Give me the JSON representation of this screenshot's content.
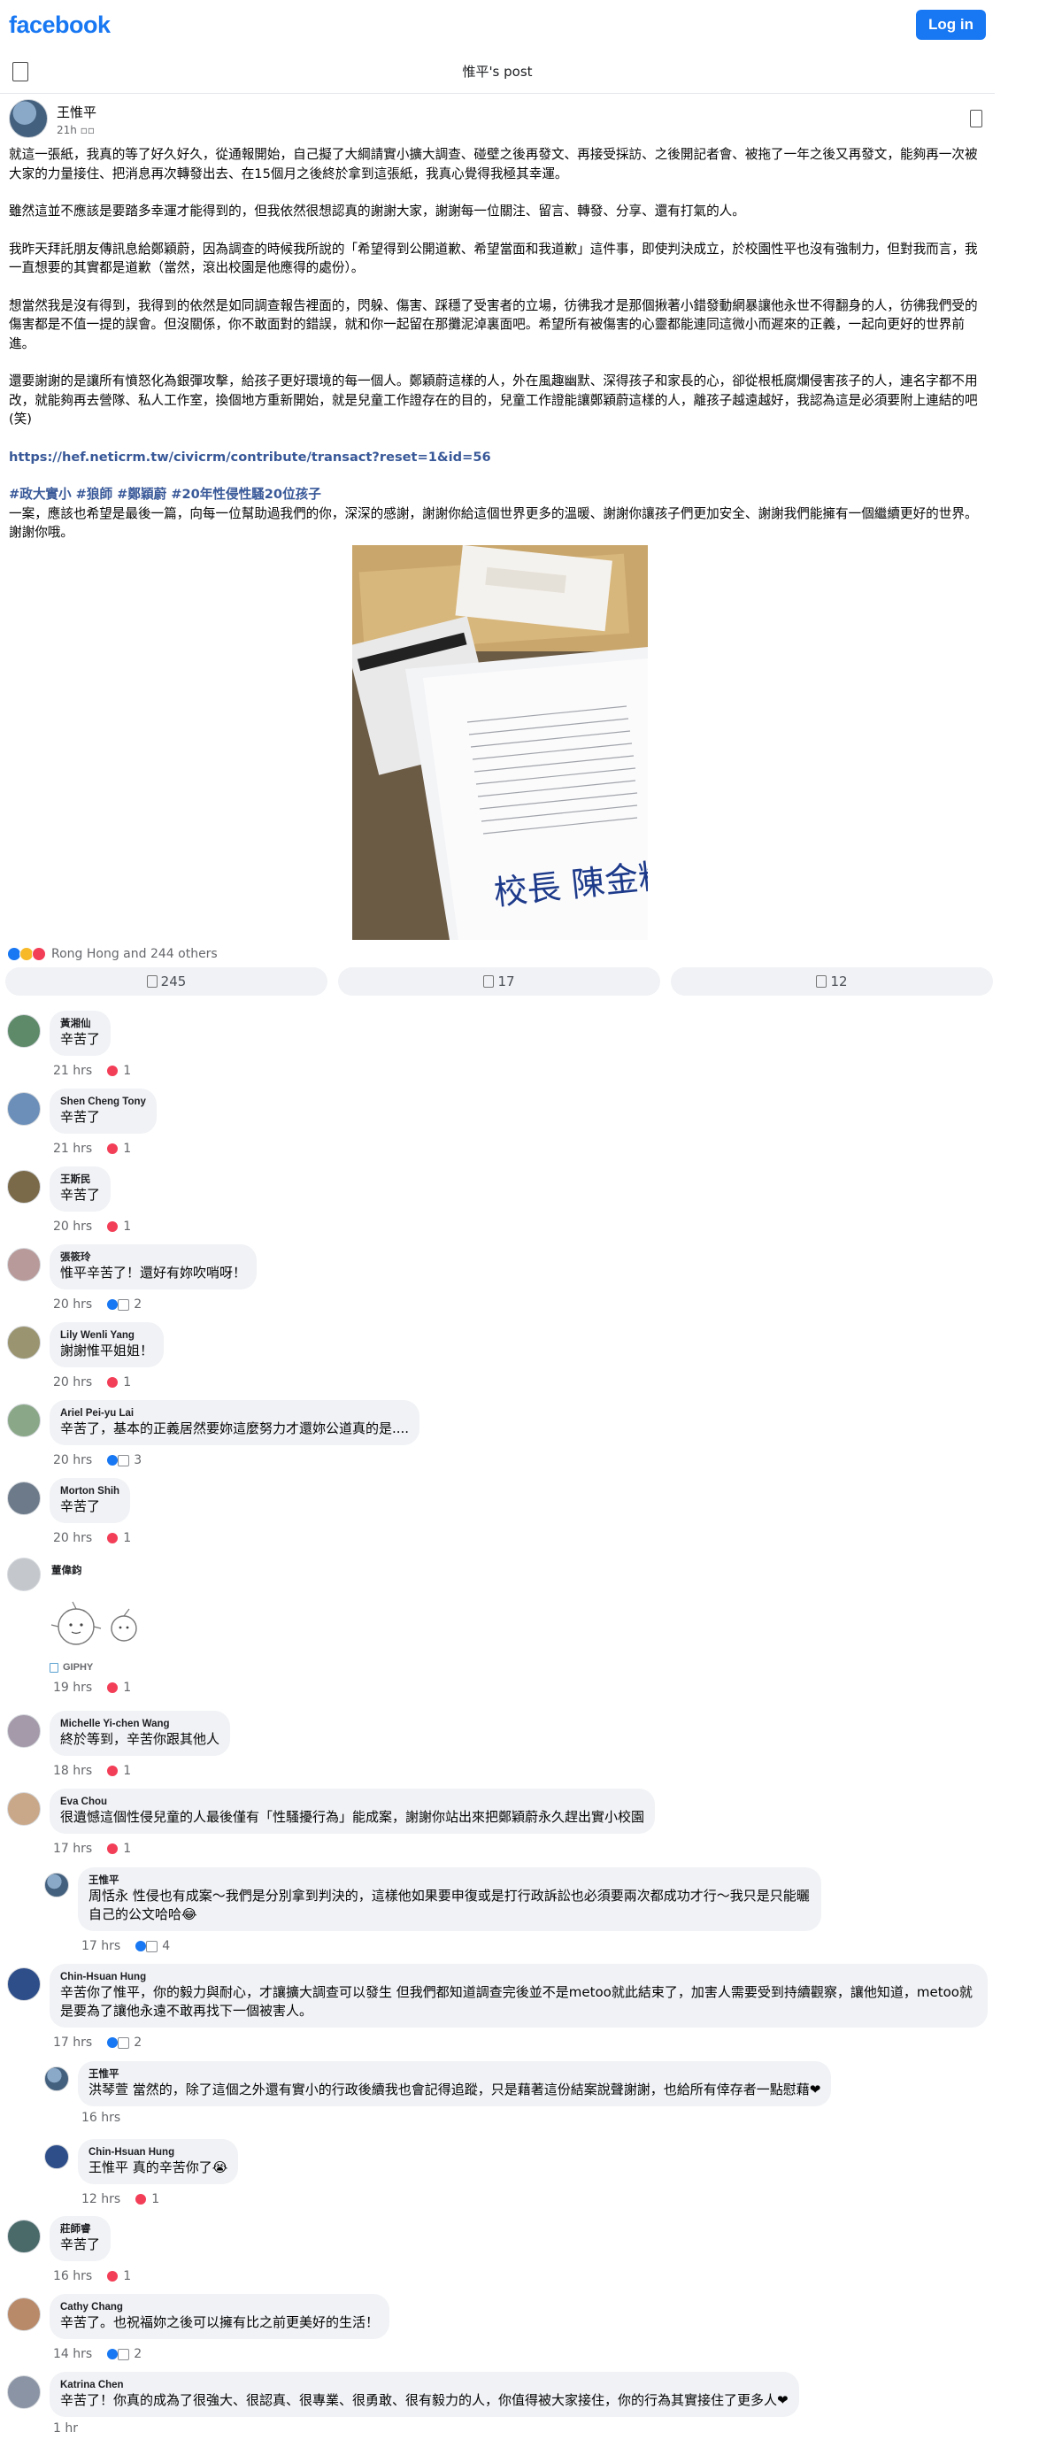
{
  "header": {
    "logo": "facebook",
    "login_label": "Log in"
  },
  "nav": {
    "title": "惟平's post"
  },
  "post": {
    "author": "王惟平",
    "time": "21h",
    "paragraphs": [
      "就這一張紙，我真的等了好久好久，從通報開始，自己擬了大綱請實小擴大調查、碰壁之後再發文、再接受採訪、之後開記者會、被拖了一年之後又再發文，能夠再一次被大家的力量接住、把消息再次轉發出去、在15個月之後終於拿到這張紙，我真心覺得我極其幸運。",
      "雖然這並不應該是要踏多幸運才能得到的，但我依然很想認真的謝謝大家，謝謝每一位關注、留言、轉發、分享、還有打氣的人。",
      "我昨天拜託朋友傳訊息給鄭穎蔚，因為調查的時候我所說的「希望得到公開道歉、希望當面和我道歉」這件事，即使判決成立，於校園性平也沒有強制力，但對我而言，我一直想要的其實都是道歉（當然，滾出校園是他應得的處份）。",
      "想當然我是沒有得到，我得到的依然是如同調查報告裡面的，閃躲、傷害、踩穩了受害者的立場，彷彿我才是那個揪著小錯發動網暴讓他永世不得翻身的人，彷彿我們受的傷害都是不值一提的誤會。但沒關係，你不敢面對的錯誤，就和你一起留在那攤泥淖裏面吧。希望所有被傷害的心靈都能連同這微小而遲來的正義，一起向更好的世界前進。",
      "還要謝謝的是讓所有憤怒化為銀彈攻擊，給孩子更好環境的每一個人。鄭穎蔚這樣的人，外在風趣幽默、深得孩子和家長的心，卻從根柢腐爛侵害孩子的人，連名字都不用改，就能夠再去營隊、私人工作室，換個地方重新開始，就是兒童工作證存在的目的，兒童工作證能讓鄭穎蔚這樣的人，離孩子越遠越好，我認為這是必須要附上連結的吧(笑)"
    ],
    "link": "https://hef.neticrm.tw/civicrm/contribute/transact?reset=1&id=56",
    "hashtags": "#政大實小 #狼師 #鄭穎蔚 #20年性侵性騷20位孩子",
    "closing": "一案，應該也希望是最後一篇，向每一位幫助過我們的你，深深的感謝，謝謝你給這個世界更多的溫暖、謝謝你讓孩子們更加安全、謝謝我們能擁有一個繼續更好的世界。謝謝你哦。",
    "photo_signature": "校長 陳金粧",
    "reactions_text": "Rong Hong and 244 others",
    "buttons": {
      "likes": "245",
      "comments": "17",
      "shares": "12"
    }
  },
  "comments": [
    {
      "name": "黃湘仙",
      "text": "辛苦了",
      "time": "21 hrs",
      "count": "1"
    },
    {
      "name": "Shen Cheng Tony",
      "text": "辛苦了",
      "time": "21 hrs",
      "count": "1"
    },
    {
      "name": "王斯民",
      "text": "辛苦了",
      "time": "20 hrs",
      "count": "1"
    },
    {
      "name": "張筱玲",
      "text": "惟平辛苦了！還好有妳吹哨呀！",
      "time": "20 hrs",
      "count": "2"
    },
    {
      "name": "Lily Wenli Yang",
      "text": "謝謝惟平姐姐！",
      "time": "20 hrs",
      "count": "1"
    },
    {
      "name": "Ariel Pei-yu Lai",
      "text": "辛苦了，基本的正義居然要妳這麼努力才還妳公道真的是....",
      "time": "20 hrs",
      "count": "3"
    },
    {
      "name": "Morton Shih",
      "text": "辛苦了",
      "time": "20 hrs",
      "count": "1"
    },
    {
      "name": "董偉鈞",
      "text": "",
      "time": "19 hrs",
      "count": "1",
      "giphy": "GIPHY"
    },
    {
      "name": "Michelle Yi-chen Wang",
      "text": "終於等到，辛苦你跟其他人",
      "time": "18 hrs",
      "count": "1"
    },
    {
      "name": "Eva Chou",
      "text": "很遺憾這個性侵兒童的人最後僅有「性騷擾行為」能成案，謝謝你站出來把鄭穎蔚永久趕出實小校園",
      "time": "17 hrs",
      "count": "1"
    },
    {
      "name": "王惟平",
      "text": "周恬永 性侵也有成案～我們是分別拿到判決的，這樣他如果要申復或是打行政訴訟也必須要兩次都成功才行～我只是只能曬自己的公文哈哈😂",
      "time": "17 hrs",
      "count": "4"
    },
    {
      "name": "Chin-Hsuan Hung",
      "text": "辛苦你了惟平，你的毅力與耐心，才讓擴大調查可以發生 但我們都知道調查完後並不是metoo就此結束了，加害人需要受到持續觀察，讓他知道，metoo就是要為了讓他永遠不敢再找下一個被害人。",
      "time": "17 hrs",
      "count": "2"
    },
    {
      "name": "王惟平",
      "text": "洪琴萱 當然的，除了這個之外還有實小的行政後續我也會記得追蹤，只是藉著這份結案說聲謝謝，也給所有倖存者一點慰藉❤",
      "time": "16 hrs",
      "count": ""
    },
    {
      "name": "Chin-Hsuan Hung",
      "text": "王惟平 真的辛苦你了😭",
      "time": "12 hrs",
      "count": "1"
    },
    {
      "name": "莊師睿",
      "text": "辛苦了",
      "time": "16 hrs",
      "count": "1"
    },
    {
      "name": "Cathy Chang",
      "text": "辛苦了。也祝福妳之後可以擁有比之前更美好的生活！",
      "time": "14 hrs",
      "count": "2"
    },
    {
      "name": "Katrina Chen",
      "text": "辛苦了！你真的成為了很強大、很認真、很專業、很勇敢、很有毅力的人，你值得被大家接住，你的行為其實接住了更多人❤",
      "time": "1 hr",
      "count": ""
    }
  ]
}
